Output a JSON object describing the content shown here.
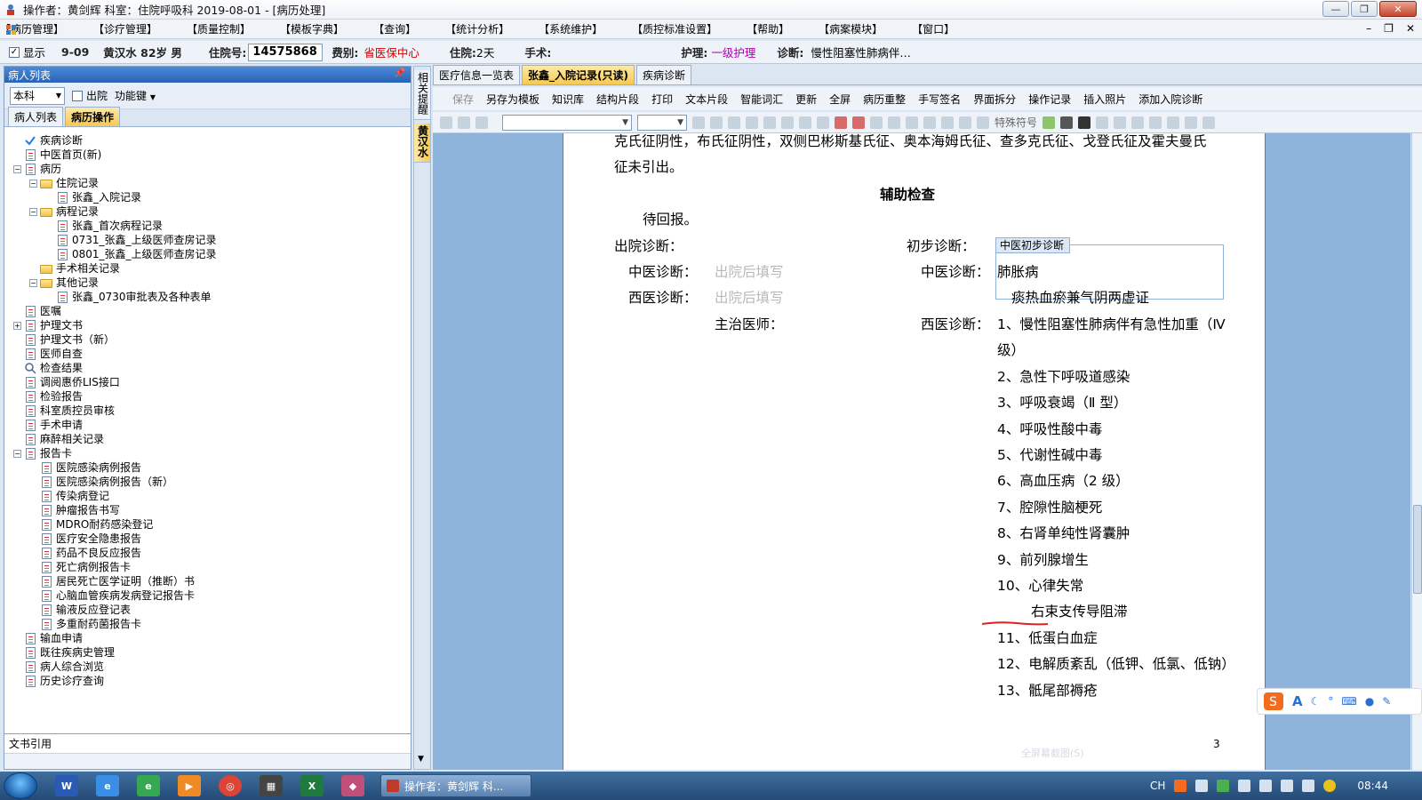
{
  "window": {
    "title": "操作者：黄剑辉  科室：住院呼吸科  2019-08-01 - [病历处理]"
  },
  "menu": [
    "【病历管理】",
    "【诊疗管理】",
    "【质量控制】",
    "【模板字典】",
    "【查询】",
    "【统计分析】",
    "【系统维护】",
    "【质控标准设置】",
    "【帮助】",
    "【病案模块】",
    "【窗口】"
  ],
  "patient": {
    "show_label": "显示",
    "bed": "9-09",
    "name_age_sex": "黄汉水 82岁 男",
    "admit_label": "住院号:",
    "admit_no": "14575868",
    "fee_label": "费别:",
    "fee_value": "省医保中心",
    "stay_label": "住院:",
    "stay_value": "2天",
    "surgery_label": "手术:",
    "nursing_label": "护理:",
    "nursing_value": "一级护理",
    "dx_label": "诊断:",
    "dx_value": "慢性阻塞性肺病伴…"
  },
  "left_panel": {
    "title": "病人列表",
    "dept_combo": "本科",
    "discharge_label": "出院",
    "func_label": "功能键",
    "tabs": [
      "病人列表",
      "病历操作"
    ],
    "footer": "文书引用",
    "tree": [
      {
        "level": 0,
        "label": "疾病诊断",
        "icon": "check-icon",
        "exp": ""
      },
      {
        "level": 0,
        "label": "中医首页(新)",
        "icon": "doc-icon",
        "exp": ""
      },
      {
        "level": 0,
        "label": "病历",
        "icon": "doc-icon",
        "exp": "-"
      },
      {
        "level": 1,
        "label": "住院记录",
        "icon": "folder-icon",
        "exp": "-"
      },
      {
        "level": 2,
        "label": "张鑫_入院记录",
        "icon": "doc-icon",
        "exp": ""
      },
      {
        "level": 1,
        "label": "病程记录",
        "icon": "folder-icon",
        "exp": "-"
      },
      {
        "level": 2,
        "label": "张鑫_首次病程记录",
        "icon": "doc-icon",
        "exp": ""
      },
      {
        "level": 2,
        "label": "0731_张鑫_上级医师查房记录",
        "icon": "doc-icon",
        "exp": ""
      },
      {
        "level": 2,
        "label": "0801_张鑫_上级医师查房记录",
        "icon": "doc-icon",
        "exp": ""
      },
      {
        "level": 1,
        "label": "手术相关记录",
        "icon": "folder-icon",
        "exp": ""
      },
      {
        "level": 1,
        "label": "其他记录",
        "icon": "folder-icon",
        "exp": "-"
      },
      {
        "level": 2,
        "label": "张鑫_0730审批表及各种表单",
        "icon": "doc-icon",
        "exp": ""
      },
      {
        "level": 0,
        "label": "医嘱",
        "icon": "doc-icon",
        "exp": ""
      },
      {
        "level": 0,
        "label": "护理文书",
        "icon": "doc-icon",
        "exp": "+"
      },
      {
        "level": 0,
        "label": "护理文书（新）",
        "icon": "doc-icon",
        "exp": ""
      },
      {
        "level": 0,
        "label": "医师自查",
        "icon": "doc-icon",
        "exp": ""
      },
      {
        "level": 0,
        "label": "检查结果",
        "icon": "search-icon",
        "exp": ""
      },
      {
        "level": 0,
        "label": "调阅惠侨LIS接口",
        "icon": "doc-icon",
        "exp": ""
      },
      {
        "level": 0,
        "label": "检验报告",
        "icon": "doc-icon",
        "exp": ""
      },
      {
        "level": 0,
        "label": "科室质控员审核",
        "icon": "doc-icon",
        "exp": ""
      },
      {
        "level": 0,
        "label": "手术申请",
        "icon": "doc-icon",
        "exp": ""
      },
      {
        "level": 0,
        "label": "麻醉相关记录",
        "icon": "doc-icon",
        "exp": ""
      },
      {
        "level": 0,
        "label": "报告卡",
        "icon": "doc-icon",
        "exp": "-"
      },
      {
        "level": 1,
        "label": "医院感染病例报告",
        "icon": "doc-icon",
        "exp": ""
      },
      {
        "level": 1,
        "label": "医院感染病例报告（新）",
        "icon": "doc-icon",
        "exp": ""
      },
      {
        "level": 1,
        "label": "传染病登记",
        "icon": "doc-icon",
        "exp": ""
      },
      {
        "level": 1,
        "label": "肿瘤报告书写",
        "icon": "doc-icon",
        "exp": ""
      },
      {
        "level": 1,
        "label": "MDRO耐药感染登记",
        "icon": "doc-icon",
        "exp": ""
      },
      {
        "level": 1,
        "label": "医疗安全隐患报告",
        "icon": "doc-icon",
        "exp": ""
      },
      {
        "level": 1,
        "label": "药品不良反应报告",
        "icon": "doc-icon",
        "exp": ""
      },
      {
        "level": 1,
        "label": "死亡病例报告卡",
        "icon": "doc-icon",
        "exp": ""
      },
      {
        "level": 1,
        "label": "居民死亡医学证明（推断）书",
        "icon": "doc-icon",
        "exp": ""
      },
      {
        "level": 1,
        "label": "心脑血管疾病发病登记报告卡",
        "icon": "doc-icon",
        "exp": ""
      },
      {
        "level": 1,
        "label": "输液反应登记表",
        "icon": "doc-icon",
        "exp": ""
      },
      {
        "level": 1,
        "label": "多重耐药菌报告卡",
        "icon": "doc-icon",
        "exp": ""
      },
      {
        "level": 0,
        "label": "输血申请",
        "icon": "doc-icon",
        "exp": ""
      },
      {
        "level": 0,
        "label": "既往疾病史管理",
        "icon": "doc-icon",
        "exp": ""
      },
      {
        "level": 0,
        "label": "病人综合浏览",
        "icon": "doc-icon",
        "exp": ""
      },
      {
        "level": 0,
        "label": "历史诊疗查询",
        "icon": "doc-icon",
        "exp": ""
      }
    ]
  },
  "side_strip": {
    "t1": "相关提醒",
    "t2": "黄汉水"
  },
  "doc_tabs": [
    "医疗信息一览表",
    "张鑫_入院记录(只读)",
    "疾病诊断"
  ],
  "toolbar": [
    "保存",
    "另存为模板",
    "知识库",
    "结构片段",
    "打印",
    "文本片段",
    "智能词汇",
    "更新",
    "全屏",
    "病历重整",
    "手写签名",
    "界面拆分",
    "操作记录",
    "插入照片",
    "添加入院诊断"
  ],
  "toolbar2_label": "特殊符号",
  "doc": {
    "line1": "克氏征阴性，布氏征阴性，双侧巴彬斯基氏征、奥本海姆氏征、查多克氏征、戈登氏征及霍夫曼氏",
    "line2": "征未引出。",
    "aux_title": "辅助检查",
    "aux_text": "待回报。",
    "discharge_dx": "出院诊断：",
    "tcm_label": "中医诊断：",
    "wm_label": "西医诊断：",
    "fill_after": "出院后填写",
    "fill_after2": "出院后填写",
    "attending": "主治医师：",
    "initial_dx": "初步诊断：",
    "tcm_initial_tag": "中医初步诊断",
    "tcm_label2": "中医诊断：",
    "tcm_dx1": "肺胀病",
    "tcm_dx2": "痰热血瘀兼气阴两虚证",
    "wm_label2": "西医诊断：",
    "wm_dx": [
      "1、慢性阻塞性肺病伴有急性加重（Ⅳ",
      "级）",
      "2、急性下呼吸道感染",
      "3、呼吸衰竭（Ⅱ 型）",
      "4、呼吸性酸中毒",
      "5、代谢性碱中毒",
      "6、高血压病（2 级）",
      "7、腔隙性脑梗死",
      "8、右肾单纯性肾囊肿",
      "9、前列腺增生",
      "10、心律失常",
      "右束支传导阻滞",
      "11、低蛋白血症",
      "12、电解质紊乱（低钾、低氯、低钠）",
      "13、骶尾部褥疮"
    ],
    "page_no": "3",
    "fullscreen_hint": "全屏幕截图(S)"
  },
  "taskbar": {
    "app": "操作者：黄剑辉  科...",
    "ime": "CH",
    "time": "08:44"
  },
  "colors": {
    "accent": "#f7c94f",
    "panel_head": "#2a63b4",
    "fee": "#d00000",
    "nursing": "#b000b0",
    "doc_bg": "#8eb4dc"
  }
}
